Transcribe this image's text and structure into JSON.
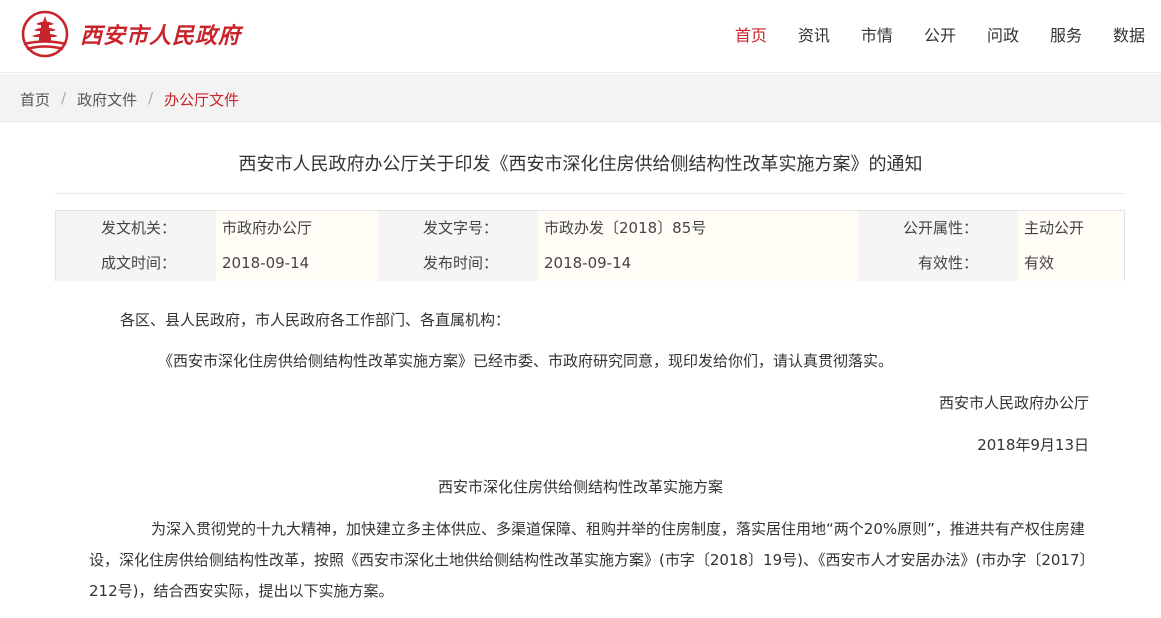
{
  "header": {
    "logo_text": "西安市人民政府",
    "nav": [
      "首页",
      "资讯",
      "市情",
      "公开",
      "问政",
      "服务",
      "数据"
    ],
    "active_index": 0,
    "brand_color": "#c8242c"
  },
  "breadcrumb": {
    "items": [
      "首页",
      "政府文件",
      "办公厅文件"
    ],
    "separator": "/"
  },
  "article": {
    "title": "西安市人民政府办公厅关于印发《西安市深化住房供给侧结构性改革实施方案》的通知",
    "meta": {
      "issuer_label": "发文机关：",
      "issuer": "市政府办公厅",
      "doc_no_label": "发文字号：",
      "doc_no": "市政办发〔2018〕85号",
      "disclosure_label": "公开属性：",
      "disclosure": "主动公开",
      "created_label": "成文时间：",
      "created": "2018-09-14",
      "published_label": "发布时间：",
      "published": "2018-09-14",
      "validity_label": "有效性：",
      "validity": "有效"
    },
    "salutation": "各区、县人民政府，市人民政府各工作部门、各直属机构：",
    "notice": "《西安市深化住房供给侧结构性改革实施方案》已经市委、市政府研究同意，现印发给你们，请认真贯彻落实。",
    "signature": "西安市人民政府办公厅",
    "date": "2018年9月13日",
    "plan_title": "西安市深化住房供给侧结构性改革实施方案",
    "paragraph": "为深入贯彻党的十九大精神，加快建立多主体供应、多渠道保障、租购并举的住房制度，落实居住用地“两个20%原则”，推进共有产权住房建设，深化住房供给侧结构性改革，按照《西安市深化土地供给侧结构性改革实施方案》(市字〔2018〕19号)、《西安市人才安居办法》(市办字〔2017〕212号)，结合西安实际，提出以下实施方案。"
  }
}
